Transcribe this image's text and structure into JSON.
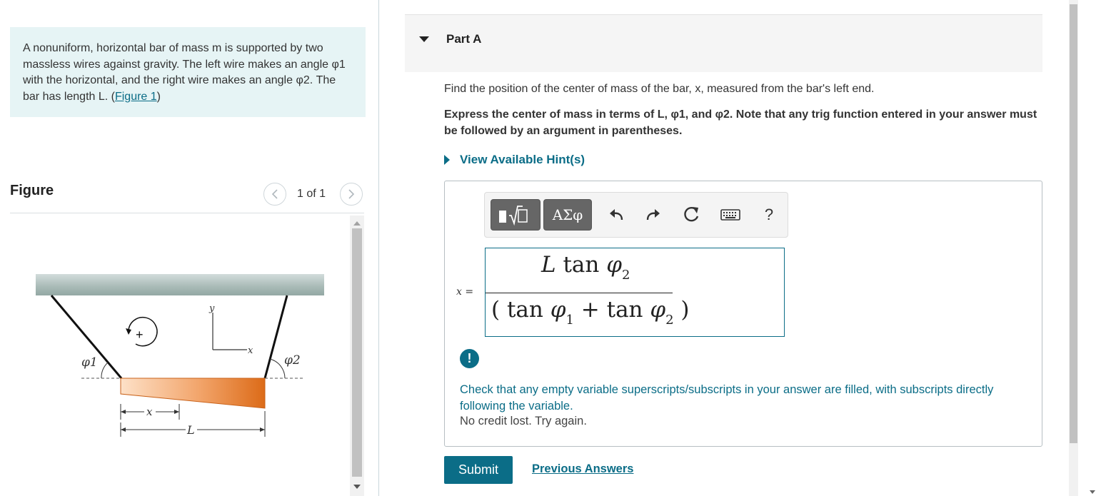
{
  "problem": {
    "intro_text": "A nonuniform, horizontal bar of mass m is supported by two massless wires against gravity. The left wire makes an angle φ1 with the horizontal, and the right wire makes an angle φ2. The bar has length L. (",
    "figure_link": "Figure 1",
    "intro_close": ")"
  },
  "figure": {
    "title": "Figure",
    "counter": "1 of 1",
    "labels": {
      "phi1": "φ1",
      "phi2": "φ2",
      "y_axis": "y",
      "x_axis": "x",
      "x_dim": "x",
      "L_dim": "L",
      "torque_sign": "+"
    }
  },
  "part": {
    "title": "Part A",
    "question": "Find the position of the center of mass of the bar, x, measured from the bar's left end.",
    "instructions": "Express the center of mass in terms of L, φ1, and φ2. Note that any trig function entered in your answer must be followed by an argument in parentheses.",
    "hints_link": "View Available Hint(s)"
  },
  "toolbar": {
    "symbols_label": "ΑΣφ",
    "help_label": "?",
    "icons": [
      "templates-icon",
      "undo-icon",
      "redo-icon",
      "reset-icon",
      "keyboard-icon"
    ]
  },
  "answer": {
    "variable_label": "x =",
    "numerator": {
      "var": "L",
      "fn": "tan",
      "sym": "φ",
      "sub": "2"
    },
    "denominator": {
      "open": "(",
      "fn1": "tan",
      "sym1": "φ",
      "sub1": "1",
      "op": "+",
      "fn2": "tan",
      "sym2": "φ",
      "sub2": "2",
      "close": ")"
    }
  },
  "feedback": {
    "icon": "!",
    "message": "Check that any empty variable superscripts/subscripts in your answer are filled, with subscripts directly following the variable.",
    "credit": "No credit lost. Try again."
  },
  "actions": {
    "submit_label": "Submit",
    "previous_answers_label": "Previous Answers"
  },
  "colors": {
    "accent": "#0b6d87",
    "intro_bg": "#e6f4f5",
    "bar_light": "#fbd9bd",
    "bar_dark": "#e0721e",
    "ceiling": "#b8c7c4"
  }
}
